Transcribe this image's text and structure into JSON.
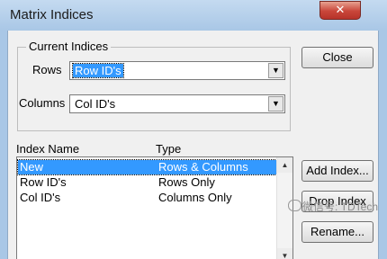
{
  "window": {
    "title": "Matrix Indices",
    "close_glyph": "✕"
  },
  "current_indices": {
    "legend": "Current Indices",
    "rows_label": "Rows",
    "rows_value": "Row ID's",
    "columns_label": "Columns",
    "columns_value": "Col ID's"
  },
  "buttons": {
    "close": "Close",
    "add_index": "Add Index...",
    "drop_index": "Drop Index",
    "rename": "Rename..."
  },
  "list": {
    "headers": [
      "Index Name",
      "Type"
    ],
    "rows": [
      {
        "name": "New",
        "type": "Rows & Columns",
        "selected": true
      },
      {
        "name": "Row ID's",
        "type": "Rows Only",
        "selected": false
      },
      {
        "name": "Col ID's",
        "type": "Columns Only",
        "selected": false
      }
    ]
  },
  "watermark": {
    "text": "微信号: TDTech",
    "icon": "wechat-icon"
  }
}
